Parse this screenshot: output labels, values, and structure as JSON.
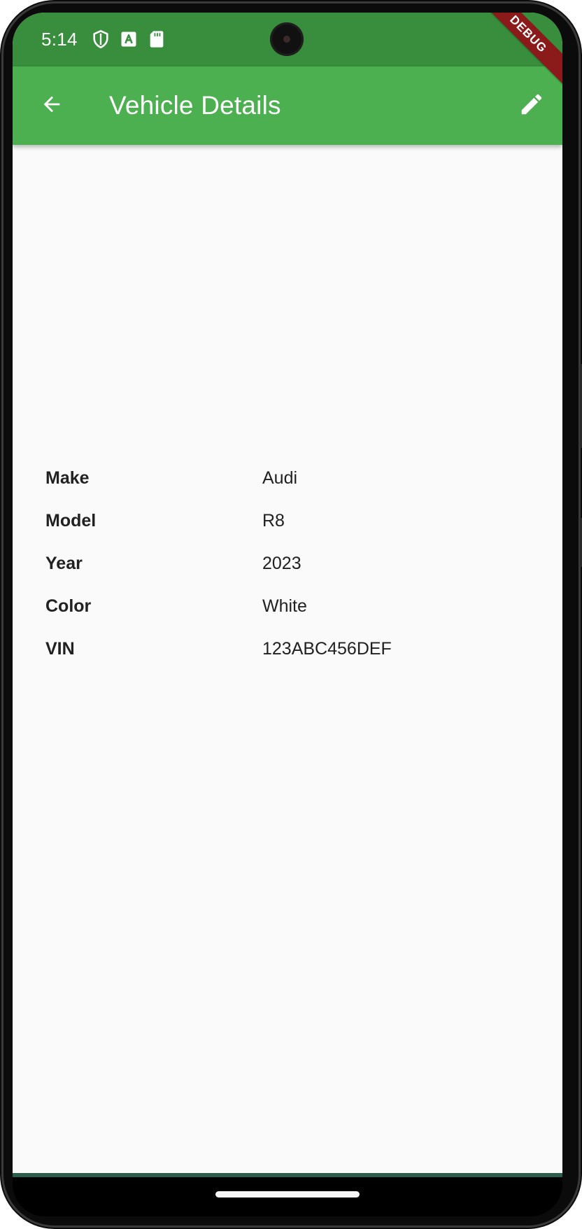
{
  "status_bar": {
    "time": "5:14",
    "icons": [
      "shield-icon",
      "a-letter-icon",
      "sd-card-icon"
    ],
    "background": "#388e3c"
  },
  "app_bar": {
    "title": "Vehicle Details",
    "back_icon": "arrow-back-icon",
    "edit_icon": "pencil-icon",
    "background": "#4caf50"
  },
  "debug_banner": {
    "label": "DEBUG",
    "color": "#8b1a1a"
  },
  "vehicle": {
    "rows": [
      {
        "label": "Make",
        "value": "Audi"
      },
      {
        "label": "Model",
        "value": "R8"
      },
      {
        "label": "Year",
        "value": "2023"
      },
      {
        "label": "Color",
        "value": "White"
      },
      {
        "label": "VIN",
        "value": "123ABC456DEF"
      }
    ]
  }
}
